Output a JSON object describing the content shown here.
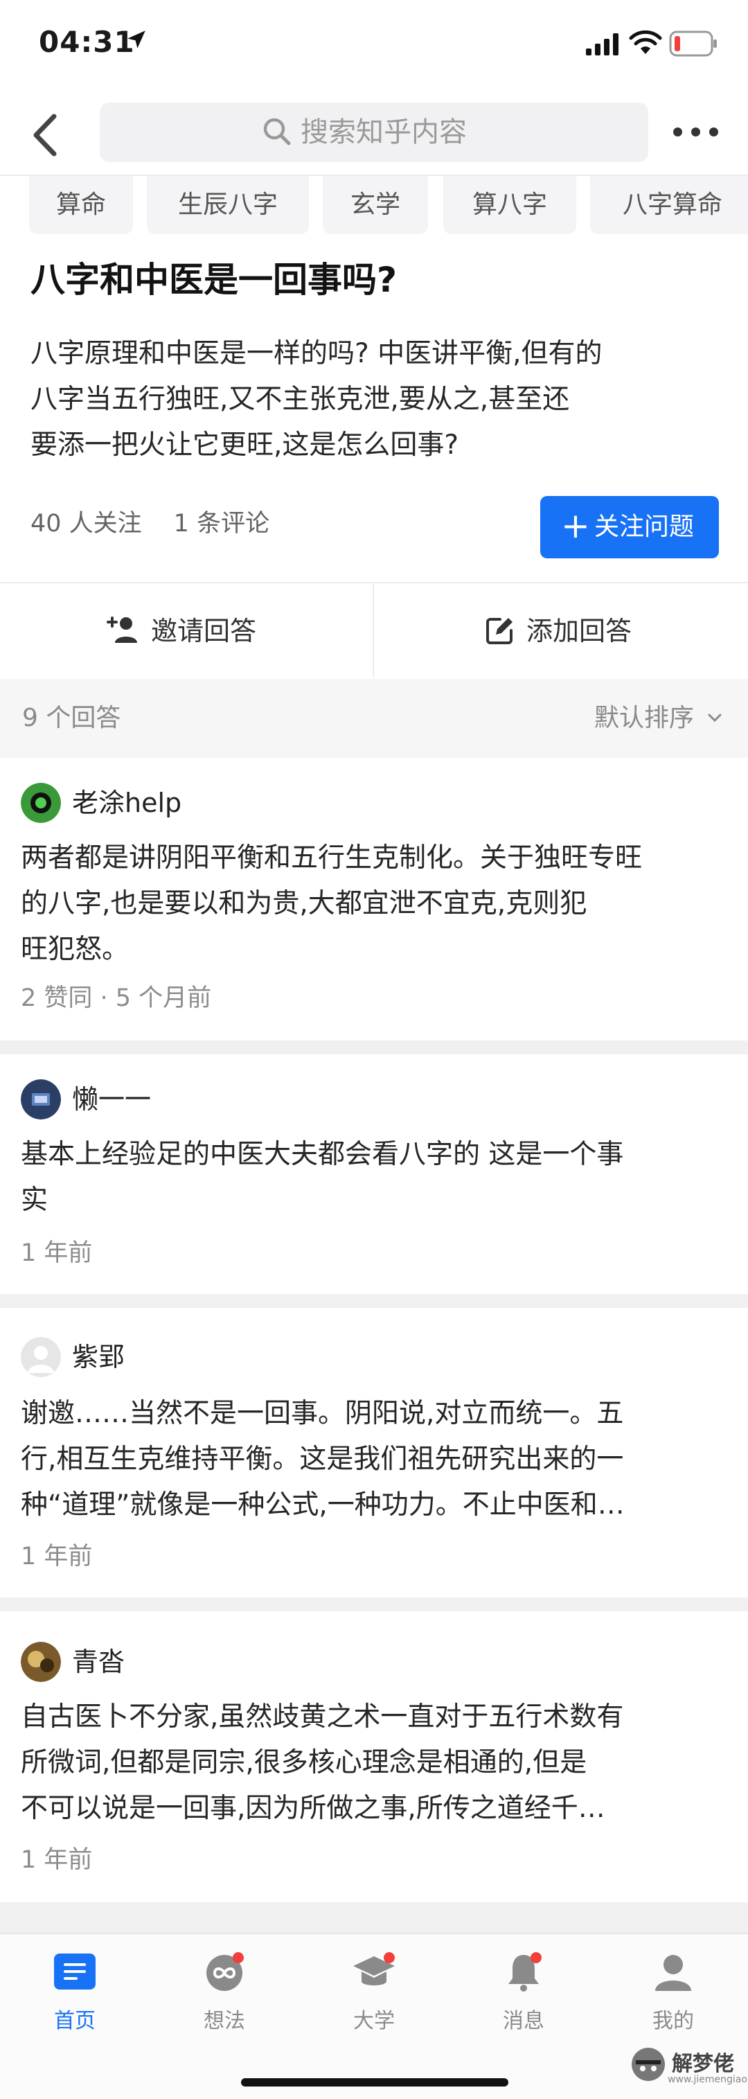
{
  "status_bar": {
    "time": "04:31"
  },
  "header": {
    "search_placeholder": "搜索知乎内容"
  },
  "tags": [
    "算命",
    "生辰八字",
    "玄学",
    "算八字",
    "八字算命"
  ],
  "question": {
    "title": "八字和中医是一回事吗?",
    "description_lines": [
      "八字原理和中医是一样的吗? 中医讲平衡,但有的",
      "八字当五行独旺,又不主张克泄,要从之,甚至还",
      "要添一把火让它更旺,这是怎么回事?"
    ],
    "followers": "40 人关注",
    "comments": "1 条评论",
    "follow_button": "关注问题"
  },
  "actions": {
    "invite": "邀请回答",
    "add_answer": "添加回答"
  },
  "answers_header": {
    "count": "9 个回答",
    "sort": "默认排序"
  },
  "answers": [
    {
      "author": "老涂help",
      "lines": [
        "两者都是讲阴阳平衡和五行生克制化。关于独旺专旺",
        "的八字,也是要以和为贵,大都宜泄不宜克,克则犯",
        "旺犯怒。"
      ],
      "meta": "2 赞同 · 5 个月前",
      "avatar_color": "#3a9a3a"
    },
    {
      "author": "懒一一",
      "lines": [
        "基本上经验足的中医大夫都会看八字的 这是一个事",
        "实"
      ],
      "meta": "1 年前",
      "avatar_color": "#2b3f66"
    },
    {
      "author": "紫郢",
      "lines": [
        "谢邀……当然不是一回事。阴阳说,对立而统一。五",
        "行,相互生克维持平衡。这是我们祖先研究出来的一",
        "种“道理”就像是一种公式,一种功力。不止中医和…"
      ],
      "meta": "1 年前",
      "avatar_color": "#e6e6e6"
    },
    {
      "author": "青沓",
      "lines": [
        "自古医卜不分家,虽然歧黄之术一直对于五行术数有",
        "所微词,但都是同宗,很多核心理念是相通的,但是",
        "不可以说是一回事,因为所做之事,所传之道经千…"
      ],
      "meta": "1 年前",
      "avatar_color": "#7a5a2a"
    }
  ],
  "tabbar": {
    "items": [
      {
        "label": "首页",
        "icon": "home-icon",
        "active": true
      },
      {
        "label": "想法",
        "icon": "idea-icon",
        "active": false
      },
      {
        "label": "大学",
        "icon": "university-icon",
        "active": false
      },
      {
        "label": "消息",
        "icon": "bell-icon",
        "active": false
      },
      {
        "label": "我的",
        "icon": "profile-icon",
        "active": false
      }
    ]
  },
  "watermark": {
    "text": "解梦佬",
    "sub": "www.jiemengiao.com"
  },
  "colors": {
    "brand": "#1772f6",
    "badge": "#f1403c"
  }
}
